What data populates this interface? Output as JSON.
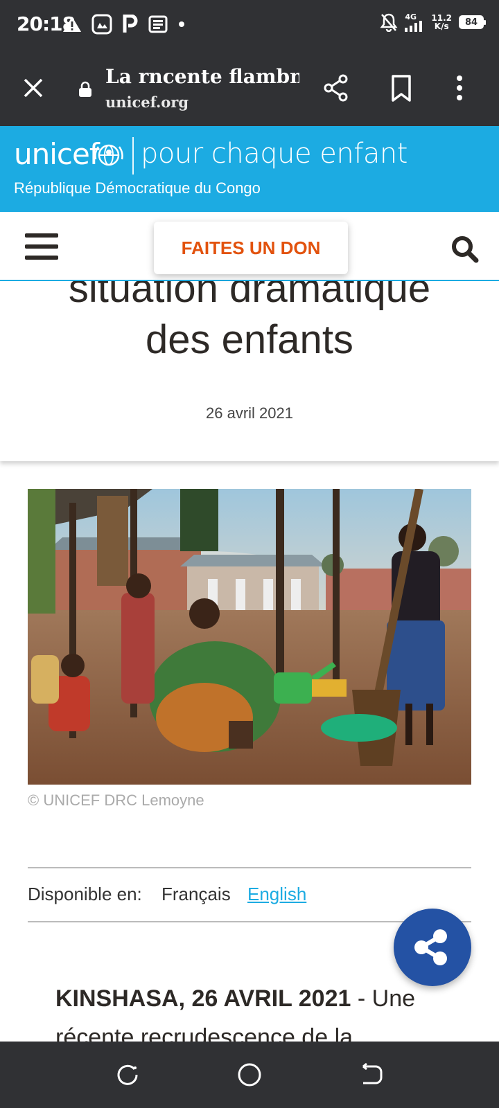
{
  "status_bar": {
    "time": "20:18",
    "network": "4G",
    "speed_value": "11.2",
    "speed_unit": "K/s",
    "battery": "84",
    "icons": [
      "warning-icon",
      "photos-icon",
      "parking-icon",
      "news-icon",
      "dot-icon",
      "mute-icon",
      "signal-icon",
      "battery-icon"
    ]
  },
  "browser": {
    "page_title": "La rncente flambne...",
    "domain": "unicef.org",
    "icons": [
      "close-icon",
      "lock-icon",
      "share-icon",
      "bookmark-icon",
      "more-vert-icon"
    ]
  },
  "banner": {
    "brand": "unicef",
    "tagline": "pour chaque enfant",
    "country": "République Démocratique du Congo",
    "accent_color": "#1cabe2"
  },
  "nav": {
    "donate_label": "FAITES UN DON",
    "donate_color": "#e2520d"
  },
  "article": {
    "headline_line1": "situation dramatique",
    "headline_line2": "des enfants",
    "date": "26 avril 2021",
    "photo_caption": "© UNICEF DRC Lemoyne",
    "lang_label": "Disponible en:",
    "lang_current": "Français",
    "lang_other": "English",
    "dateline": "KINSHASA, 26 AVRIL 2021",
    "lead_text": " - Une récente recrudescence de la"
  },
  "share_fab": {
    "icon": "share-icon",
    "color": "#2452a4"
  },
  "system_nav": {
    "icons": [
      "recents-icon",
      "home-icon",
      "back-icon"
    ]
  }
}
